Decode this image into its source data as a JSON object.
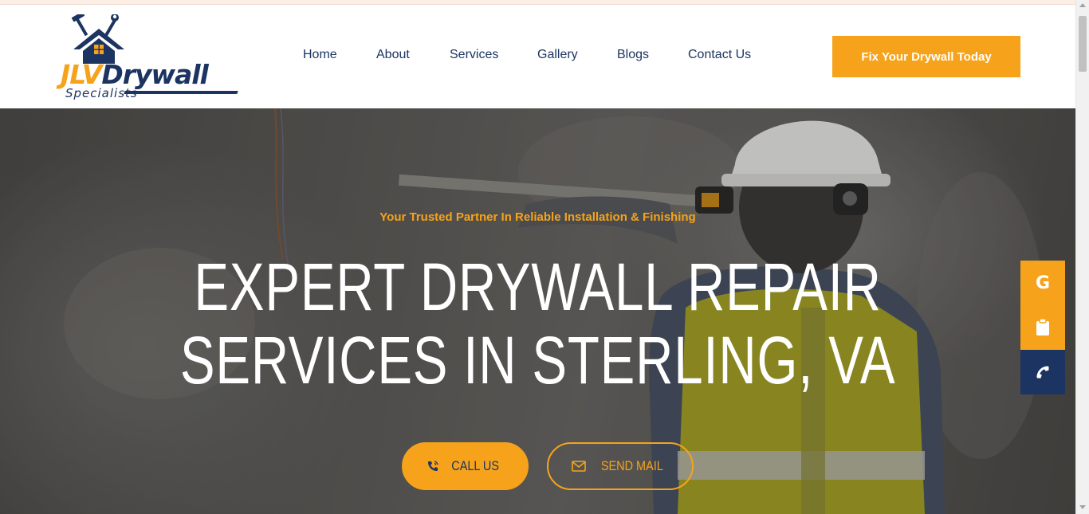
{
  "brand": {
    "logo_main_a": "JLV",
    "logo_main_b": "Drywall",
    "logo_sub": "Specialists"
  },
  "nav": {
    "items": [
      {
        "label": "Home"
      },
      {
        "label": "About"
      },
      {
        "label": "Services"
      },
      {
        "label": "Gallery"
      },
      {
        "label": "Blogs"
      },
      {
        "label": "Contact Us"
      }
    ],
    "cta_label": "Fix Your Drywall Today"
  },
  "hero": {
    "tagline": "Your Trusted Partner In Reliable Installation & Finishing",
    "title_line1": "EXPERT DRYWALL REPAIR",
    "title_line2": "SERVICES IN STERLING, VA",
    "call_label": "CALL US",
    "mail_label": "SEND MAIL"
  },
  "floating": {
    "google_glyph": "G"
  },
  "colors": {
    "accent": "#f6a31b",
    "navy": "#1c3461",
    "white": "#ffffff"
  }
}
